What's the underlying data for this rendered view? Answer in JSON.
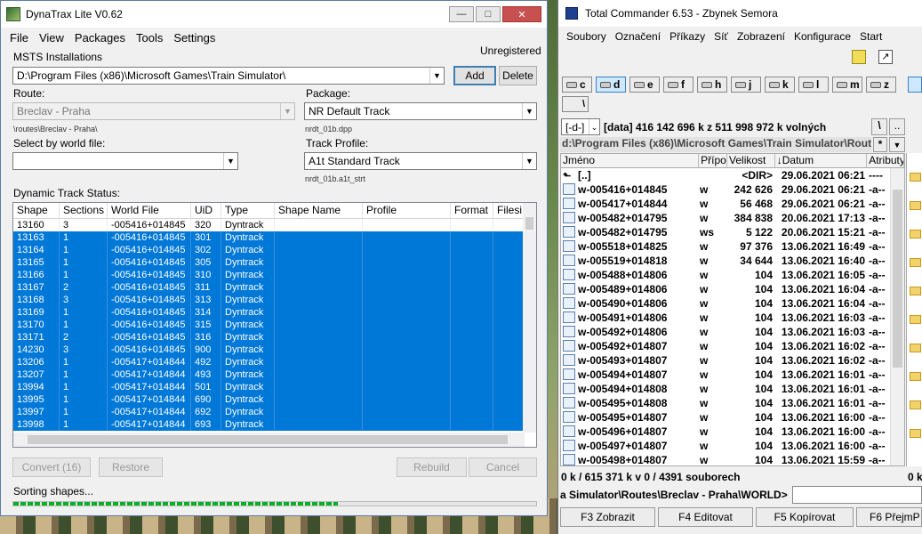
{
  "dynatrax": {
    "title": "DynaTrax Lite V0.62",
    "menu": [
      "File",
      "View",
      "Packages",
      "Tools",
      "Settings"
    ],
    "registration": "Unregistered",
    "msts_label": "MSTS Installations",
    "msts_value": "D:\\Program Files (x86)\\Microsoft Games\\Train Simulator\\",
    "add_label": "Add",
    "delete_label": "Delete",
    "route_label": "Route:",
    "route_value": "Breclav - Praha",
    "route_path": "\\routes\\Breclav - Praha\\",
    "package_label": "Package:",
    "package_value": "NR Default Track",
    "package_file": "nrdt_01b.dpp",
    "world_label": "Select by world file:",
    "world_value": "",
    "profile_label": "Track Profile:",
    "profile_value": "A1t Standard Track",
    "profile_file": "nrdt_01b.a1t_strt",
    "status_label": "Dynamic Track Status:",
    "columns": [
      "Shape",
      "Sections",
      "World File",
      "UiD",
      "Type",
      "Shape Name",
      "Profile",
      "Format",
      "Filesi"
    ],
    "rows": [
      {
        "shape": "13160",
        "sections": "3",
        "world": "-005416+014845",
        "uid": "320",
        "type": "Dyntrack",
        "selected": false
      },
      {
        "shape": "13163",
        "sections": "1",
        "world": "-005416+014845",
        "uid": "301",
        "type": "Dyntrack",
        "selected": true
      },
      {
        "shape": "13164",
        "sections": "1",
        "world": "-005416+014845",
        "uid": "302",
        "type": "Dyntrack",
        "selected": true
      },
      {
        "shape": "13165",
        "sections": "1",
        "world": "-005416+014845",
        "uid": "305",
        "type": "Dyntrack",
        "selected": true
      },
      {
        "shape": "13166",
        "sections": "1",
        "world": "-005416+014845",
        "uid": "310",
        "type": "Dyntrack",
        "selected": true
      },
      {
        "shape": "13167",
        "sections": "2",
        "world": "-005416+014845",
        "uid": "311",
        "type": "Dyntrack",
        "selected": true
      },
      {
        "shape": "13168",
        "sections": "3",
        "world": "-005416+014845",
        "uid": "313",
        "type": "Dyntrack",
        "selected": true
      },
      {
        "shape": "13169",
        "sections": "1",
        "world": "-005416+014845",
        "uid": "314",
        "type": "Dyntrack",
        "selected": true
      },
      {
        "shape": "13170",
        "sections": "1",
        "world": "-005416+014845",
        "uid": "315",
        "type": "Dyntrack",
        "selected": true
      },
      {
        "shape": "13171",
        "sections": "2",
        "world": "-005416+014845",
        "uid": "316",
        "type": "Dyntrack",
        "selected": true
      },
      {
        "shape": "14230",
        "sections": "3",
        "world": "-005416+014845",
        "uid": "900",
        "type": "Dyntrack",
        "selected": true
      },
      {
        "shape": "13206",
        "sections": "1",
        "world": "-005417+014844",
        "uid": "492",
        "type": "Dyntrack",
        "selected": true
      },
      {
        "shape": "13207",
        "sections": "1",
        "world": "-005417+014844",
        "uid": "493",
        "type": "Dyntrack",
        "selected": true
      },
      {
        "shape": "13994",
        "sections": "1",
        "world": "-005417+014844",
        "uid": "501",
        "type": "Dyntrack",
        "selected": true
      },
      {
        "shape": "13995",
        "sections": "1",
        "world": "-005417+014844",
        "uid": "690",
        "type": "Dyntrack",
        "selected": true
      },
      {
        "shape": "13997",
        "sections": "1",
        "world": "-005417+014844",
        "uid": "692",
        "type": "Dyntrack",
        "selected": true
      },
      {
        "shape": "13998",
        "sections": "1",
        "world": "-005417+014844",
        "uid": "693",
        "type": "Dyntrack",
        "selected": true
      }
    ],
    "buttons": {
      "convert": "Convert (16)",
      "restore": "Restore",
      "rebuild": "Rebuild",
      "cancel": "Cancel"
    },
    "status_text": "Sorting shapes...",
    "progress": 0.62
  },
  "tc": {
    "title": "Total Commander 6.53 - Zbynek Semora",
    "menu": [
      "Soubory",
      "Označení",
      "Příkazy",
      "Síť",
      "Zobrazení",
      "Konfigurace",
      "Start"
    ],
    "drives": [
      "c",
      "d",
      "e",
      "f",
      "h",
      "j",
      "k",
      "l",
      "m",
      "z"
    ],
    "active_drive": "d",
    "drive_combo": "[-d-]",
    "drive_info": "[data]  416 142 696 k z 511 998 972 k volných",
    "path": "d:\\Program Files (x86)\\Microsoft Games\\Train Simulator\\Rout",
    "path_star": "*",
    "cols": [
      "Jméno",
      "Přípo",
      "Velikost",
      "↓Datum",
      "Atributy"
    ],
    "files": [
      {
        "name": "[..]",
        "ext": "",
        "size": "<DIR>",
        "date": "29.06.2021 06:21",
        "attr": "----"
      },
      {
        "name": "w-005416+014845",
        "ext": "w",
        "size": "242 626",
        "date": "29.06.2021 06:21",
        "attr": "-a--"
      },
      {
        "name": "w-005417+014844",
        "ext": "w",
        "size": "56 468",
        "date": "29.06.2021 06:21",
        "attr": "-a--"
      },
      {
        "name": "w-005482+014795",
        "ext": "w",
        "size": "384 838",
        "date": "20.06.2021 17:13",
        "attr": "-a--"
      },
      {
        "name": "w-005482+014795",
        "ext": "ws",
        "size": "5 122",
        "date": "20.06.2021 15:21",
        "attr": "-a--"
      },
      {
        "name": "w-005518+014825",
        "ext": "w",
        "size": "97 376",
        "date": "13.06.2021 16:49",
        "attr": "-a--"
      },
      {
        "name": "w-005519+014818",
        "ext": "w",
        "size": "34 644",
        "date": "13.06.2021 16:40",
        "attr": "-a--"
      },
      {
        "name": "w-005488+014806",
        "ext": "w",
        "size": "104",
        "date": "13.06.2021 16:05",
        "attr": "-a--"
      },
      {
        "name": "w-005489+014806",
        "ext": "w",
        "size": "104",
        "date": "13.06.2021 16:04",
        "attr": "-a--"
      },
      {
        "name": "w-005490+014806",
        "ext": "w",
        "size": "104",
        "date": "13.06.2021 16:04",
        "attr": "-a--"
      },
      {
        "name": "w-005491+014806",
        "ext": "w",
        "size": "104",
        "date": "13.06.2021 16:03",
        "attr": "-a--"
      },
      {
        "name": "w-005492+014806",
        "ext": "w",
        "size": "104",
        "date": "13.06.2021 16:03",
        "attr": "-a--"
      },
      {
        "name": "w-005492+014807",
        "ext": "w",
        "size": "104",
        "date": "13.06.2021 16:02",
        "attr": "-a--"
      },
      {
        "name": "w-005493+014807",
        "ext": "w",
        "size": "104",
        "date": "13.06.2021 16:02",
        "attr": "-a--"
      },
      {
        "name": "w-005494+014807",
        "ext": "w",
        "size": "104",
        "date": "13.06.2021 16:01",
        "attr": "-a--"
      },
      {
        "name": "w-005494+014808",
        "ext": "w",
        "size": "104",
        "date": "13.06.2021 16:01",
        "attr": "-a--"
      },
      {
        "name": "w-005495+014808",
        "ext": "w",
        "size": "104",
        "date": "13.06.2021 16:01",
        "attr": "-a--"
      },
      {
        "name": "w-005495+014807",
        "ext": "w",
        "size": "104",
        "date": "13.06.2021 16:00",
        "attr": "-a--"
      },
      {
        "name": "w-005496+014807",
        "ext": "w",
        "size": "104",
        "date": "13.06.2021 16:00",
        "attr": "-a--"
      },
      {
        "name": "w-005497+014807",
        "ext": "w",
        "size": "104",
        "date": "13.06.2021 16:00",
        "attr": "-a--"
      },
      {
        "name": "w-005498+014807",
        "ext": "w",
        "size": "104",
        "date": "13.06.2021 15:59",
        "attr": "-a--"
      }
    ],
    "selection_info": "0 k / 615 371 k v 0 / 4391 souborech",
    "right_info": "0 k",
    "cmd_path": "a Simulator\\Routes\\Breclav - Praha\\WORLD>",
    "fkeys": [
      "F3 Zobrazit",
      "F4 Editovat",
      "F5 Kopírovat",
      "F6 PřejmP"
    ]
  }
}
